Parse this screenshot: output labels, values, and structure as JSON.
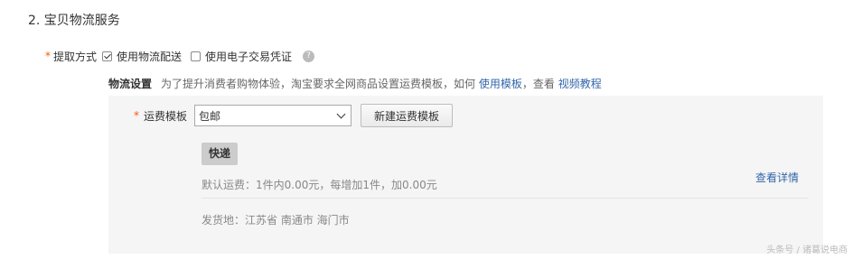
{
  "section": {
    "title": "2. 宝贝物流服务"
  },
  "fetch": {
    "required_mark": "*",
    "label": "提取方式",
    "options": [
      {
        "label": "使用物流配送",
        "checked": true
      },
      {
        "label": "使用电子交易凭证",
        "checked": false
      }
    ],
    "help_icon": "?"
  },
  "logistics": {
    "title": "物流设置",
    "desc": "为了提升消费者购物体验，淘宝要求全网商品设置运费模板，如何",
    "link_use_template": "使用模板",
    "sep": "，查看",
    "link_video": "视频教程"
  },
  "template": {
    "required_mark": "*",
    "label": "运费模板",
    "selected": "包邮",
    "new_button": "新建运费模板"
  },
  "card": {
    "tag": "快递",
    "fee_text": "默认运费：1件内0.00元，每增加1件，加0.00元",
    "detail_link": "查看详情",
    "origin": "发货地：江苏省 南通市 海门市"
  },
  "watermark": "头条号 / 诸葛说电商"
}
